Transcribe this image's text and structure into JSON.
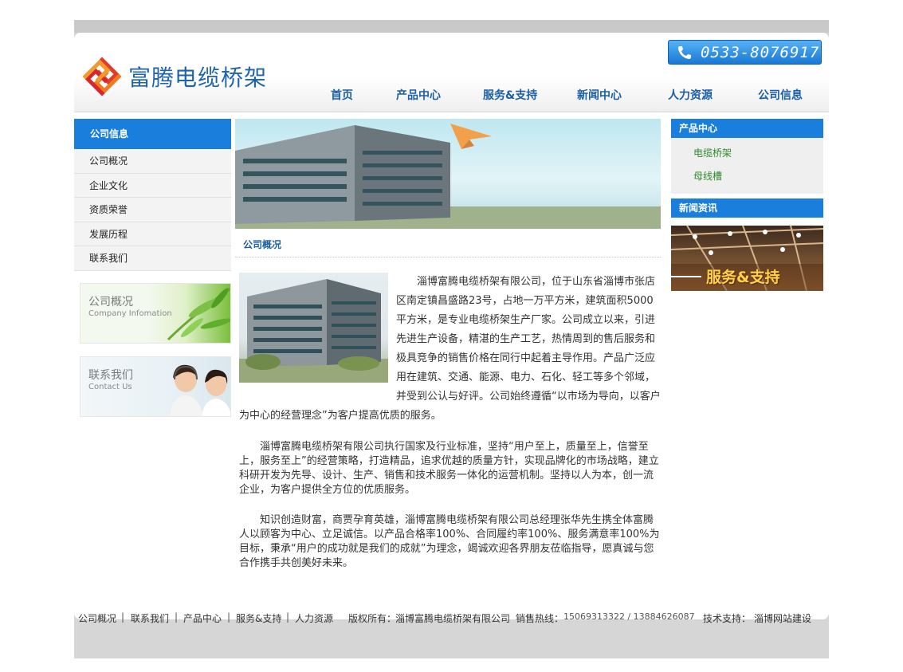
{
  "header": {
    "logo_text": "富腾电缆桥架",
    "phone": "0533-8076917"
  },
  "nav": {
    "items": [
      "首页",
      "产品中心",
      "服务&支持",
      "新闻中心",
      "人力资源",
      "公司信息"
    ]
  },
  "sidebar": {
    "title": "公司信息",
    "items": [
      "公司概况",
      "企业文化",
      "资质荣誉",
      "发展历程",
      "联系我们"
    ],
    "promo_company": {
      "title": "公司概况",
      "subtitle": "Company Infomation"
    },
    "promo_contact": {
      "title": "联系我们",
      "subtitle": "Contact Us"
    }
  },
  "main": {
    "section_title": "公司概况",
    "para1": "淄博富腾电缆桥架有限公司，位于山东省淄博市张店区南定镇昌盛路23号，占地一万平方米，建筑面积5000平方米，是专业电缆桥架生产厂家。公司成立以来，引进先进生产设备，精湛的生产工艺，热情周到的售后服务和极具竞争的销售价格在同行中起着主导作用。产品广泛应用在建筑、交通、能源、电力、石化、轻工等多个邻域，并受到公认与好评。公司始终遵循“以市场为导向，以客户为中心的经营理念”为客户提高优质的服务。",
    "para2": "淄博富腾电缆桥架有限公司执行国家及行业标准，坚持“用户至上，质量至上，信誉至上，服务至上”的经营策略，打造精品，追求优越的质量方针，实现品牌化的市场战略，建立科研开发为先导、设计、生产、销售和技术服务一体化的运营机制。坚持以人为本，创一流企业，为客户提供全方位的优质服务。",
    "para3": "知识创造财富，商贾孕育英雄，淄博富腾电缆桥架有限公司总经理张华先生携全体富腾人以顾客为中心、立足诚信。以产品合格率100%、合同履约率100%、服务满意率100%为目标，秉承“用户的成功就是我们的成就”为理念，竭诚欢迎各界朋友莅临指导，愿真诚与您合作携手共创美好未来。"
  },
  "right": {
    "products_title": "产品中心",
    "products": [
      "电缆桥架",
      "母线槽"
    ],
    "news_title": "新闻资讯",
    "service_banner_text": "服务&支持"
  },
  "footer": {
    "links": [
      "公司概况",
      "联系我们",
      "产品中心",
      "服务&支持",
      "人力资源"
    ],
    "separator": "|",
    "copyright_label": "版权所有：",
    "copyright_value": "淄博富腾电缆桥架有限公司",
    "hotline_label": "销售热线：",
    "hotline_value": "15069313322 / 13884626087",
    "support_label": "技术支持：",
    "support_value": "淄博网站建设"
  },
  "colors": {
    "brand_blue": "#1a7fdc",
    "nav_blue": "#1b5fa6",
    "link_green": "#2d8a2d",
    "logo_red": "#e23b2a"
  }
}
